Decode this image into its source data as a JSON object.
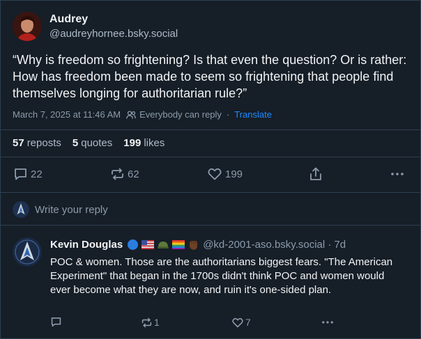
{
  "post": {
    "author_name": "Audrey",
    "author_handle": "@audreyhornee.bsky.social",
    "text": "“Why is freedom so frightening? Is that even the question? Or is rather: How has freedom been made to seem so frightening that people find themselves longing for authoritarian rule?”",
    "timestamp": "March 7, 2025 at 11:46 AM",
    "reply_setting": "Everybody can reply",
    "separator": "·",
    "translate_label": "Translate",
    "stats": {
      "reposts_count": "57",
      "reposts_label": "reposts",
      "quotes_count": "5",
      "quotes_label": "quotes",
      "likes_count": "199",
      "likes_label": "likes"
    },
    "actions": {
      "reply_count": "22",
      "repost_count": "62",
      "like_count": "199"
    }
  },
  "reply_box": {
    "placeholder": "Write your reply"
  },
  "reply": {
    "author_name": "Kevin Douglas",
    "author_handle": "@kd-2001-aso.bsky.social",
    "age": "· 7d",
    "text": "POC & women. Those are the authoritarians biggest fears. \"The American Experiment\" that began in the 1700s didn't think POC and women would ever become what they are now, and ruin it's one-sided plan.",
    "repost_count": "1",
    "like_count": "7"
  },
  "icons": {
    "reply": "speech-bubble-icon",
    "repost": "repost-arrows-icon",
    "like": "heart-icon",
    "share": "share-icon",
    "more": "ellipsis-icon",
    "audience": "people-icon"
  },
  "colors": {
    "background": "#161e27",
    "border": "#2e4052",
    "text": "#f1f3f5",
    "muted": "#8c9bab",
    "link": "#208bfe"
  }
}
